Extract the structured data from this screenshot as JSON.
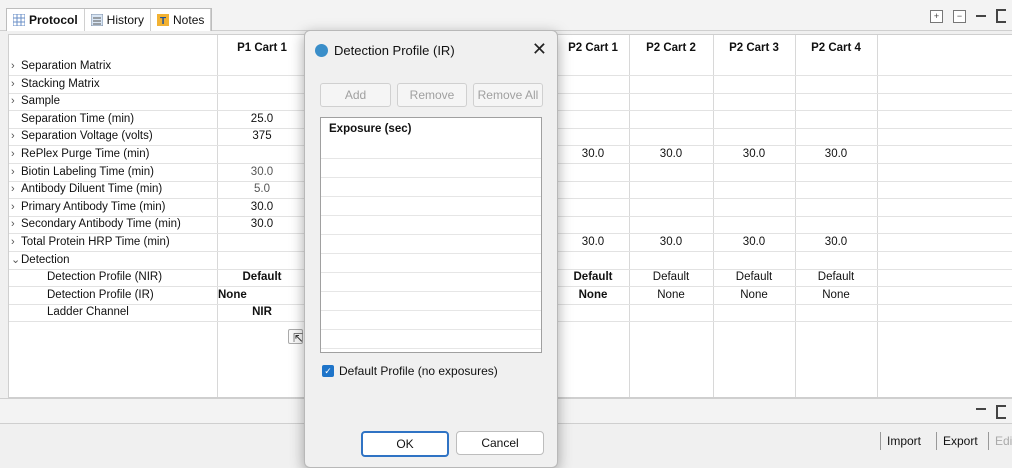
{
  "tabs": [
    {
      "label": "Protocol",
      "icon": "grid-icon",
      "active": true
    },
    {
      "label": "History",
      "icon": "history-icon",
      "active": false
    },
    {
      "label": "Notes",
      "icon": "notes-icon",
      "active": false
    }
  ],
  "table": {
    "col_p1c1": "P1 Cart 1",
    "col_p2c1": "P2 Cart 1",
    "col_p2c2": "P2 Cart 2",
    "col_p2c3": "P2 Cart 3",
    "col_p2c4": "P2 Cart 4",
    "rows": [
      {
        "label": "Separation Matrix",
        "arrow": ">",
        "p1": "",
        "p2c1": "",
        "p2c2": "",
        "p2c3": "",
        "p2c4": ""
      },
      {
        "label": "Stacking Matrix",
        "arrow": ">",
        "p1": "",
        "p2c1": "",
        "p2c2": "",
        "p2c3": "",
        "p2c4": ""
      },
      {
        "label": "Sample",
        "arrow": ">",
        "p1": "",
        "p2c1": "",
        "p2c2": "",
        "p2c3": "",
        "p2c4": ""
      },
      {
        "label": "Separation Time (min)",
        "arrow": "",
        "p1": "25.0",
        "p2c1": "",
        "p2c2": "",
        "p2c3": "",
        "p2c4": ""
      },
      {
        "label": "Separation Voltage (volts)",
        "arrow": ">",
        "p1": "375",
        "p2c1": "",
        "p2c2": "",
        "p2c3": "",
        "p2c4": ""
      },
      {
        "label": "RePlex Purge Time (min)",
        "arrow": ">",
        "p1": "",
        "p2c1": "30.0",
        "p2c2": "30.0",
        "p2c3": "30.0",
        "p2c4": "30.0"
      },
      {
        "label": "Biotin Labeling Time (min)",
        "arrow": ">",
        "p1": "30.0",
        "p2c1": "",
        "p2c2": "",
        "p2c3": "",
        "p2c4": ""
      },
      {
        "label": "Antibody Diluent Time (min)",
        "arrow": ">",
        "p1": "5.0",
        "p2c1": "",
        "p2c2": "",
        "p2c3": "",
        "p2c4": ""
      },
      {
        "label": "Primary Antibody Time (min)",
        "arrow": ">",
        "p1": "30.0",
        "p2c1": "",
        "p2c2": "",
        "p2c3": "",
        "p2c4": ""
      },
      {
        "label": "Secondary Antibody Time (min)",
        "arrow": ">",
        "p1": "30.0",
        "p2c1": "",
        "p2c2": "",
        "p2c3": "",
        "p2c4": ""
      },
      {
        "label": "Total Protein HRP Time (min)",
        "arrow": ">",
        "p1": "",
        "p2c1": "30.0",
        "p2c2": "30.0",
        "p2c3": "30.0",
        "p2c4": "30.0"
      },
      {
        "label": "Detection",
        "arrow": "v",
        "p1": "",
        "p2c1": "",
        "p2c2": "",
        "p2c3": "",
        "p2c4": ""
      },
      {
        "label": "Detection Profile (NIR)",
        "arrow": "",
        "p1": "Default",
        "p2c1": "Default",
        "p2c2": "Default",
        "p2c3": "Default",
        "p2c4": "Default"
      },
      {
        "label": "Detection Profile (IR)",
        "arrow": "",
        "p1": "None",
        "p2c1": "None",
        "p2c2": "None",
        "p2c3": "None",
        "p2c4": "None"
      },
      {
        "label": "Ladder Channel",
        "arrow": "",
        "p1": "NIR",
        "p2c1": "",
        "p2c2": "",
        "p2c3": "",
        "p2c4": ""
      }
    ]
  },
  "actions": {
    "import": "Import",
    "export": "Export",
    "edit": "Edi"
  },
  "dialog": {
    "title": "Detection Profile (IR)",
    "add": "Add",
    "remove": "Remove",
    "remove_all": "Remove All",
    "list_header": "Exposure (sec)",
    "checkbox_label": "Default Profile (no exposures)",
    "checkbox_checked": true,
    "ok": "OK",
    "cancel": "Cancel"
  }
}
